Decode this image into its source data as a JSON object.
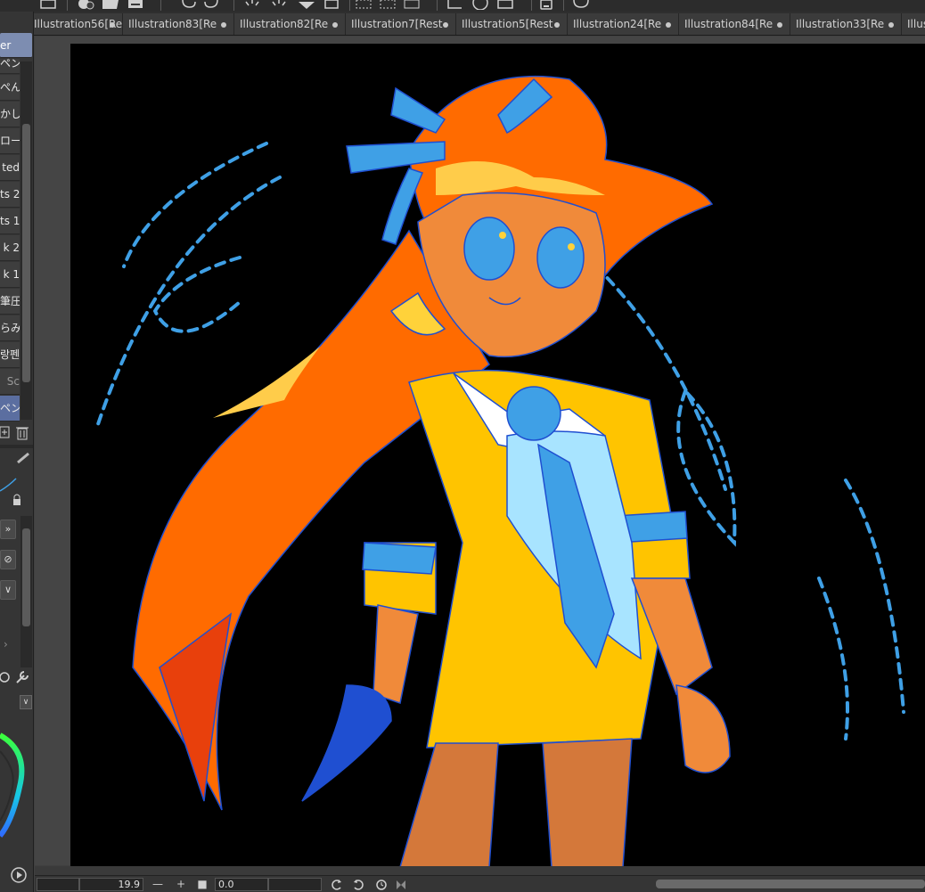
{
  "tabs": [
    {
      "label": "Illustration56[Re"
    },
    {
      "label": "Illustration83[Re"
    },
    {
      "label": "Illustration82[Re"
    },
    {
      "label": "Illustration7[Rest"
    },
    {
      "label": "Illustration5[Rest"
    },
    {
      "label": "Illustration24[Re"
    },
    {
      "label": "Illustration84[Re"
    },
    {
      "label": "Illustration33[Re"
    },
    {
      "label": "Illus"
    }
  ],
  "brushes": [
    {
      "label": "er"
    },
    {
      "label": "ペン"
    },
    {
      "label": "ぺん"
    },
    {
      "label": "かし"
    },
    {
      "label": "ロー"
    },
    {
      "label": "ted"
    },
    {
      "label": "ts 2"
    },
    {
      "label": "ts 1"
    },
    {
      "label": "k 2"
    },
    {
      "label": "k 1"
    },
    {
      "label": "筆圧"
    },
    {
      "label": "らみ"
    },
    {
      "label": "랑펜"
    },
    {
      "label": "Sc"
    },
    {
      "label": "ペン"
    }
  ],
  "bottom": {
    "zoom": "19.9",
    "zoom_minus": "—",
    "zoom_plus": "+",
    "angle": "0.0"
  },
  "colors": {
    "hair": "#ff6b00",
    "outfit": "#ffc400",
    "tie": "#3fa0e6",
    "skin": "#f08a3a",
    "outline": "#1f4fd1"
  }
}
